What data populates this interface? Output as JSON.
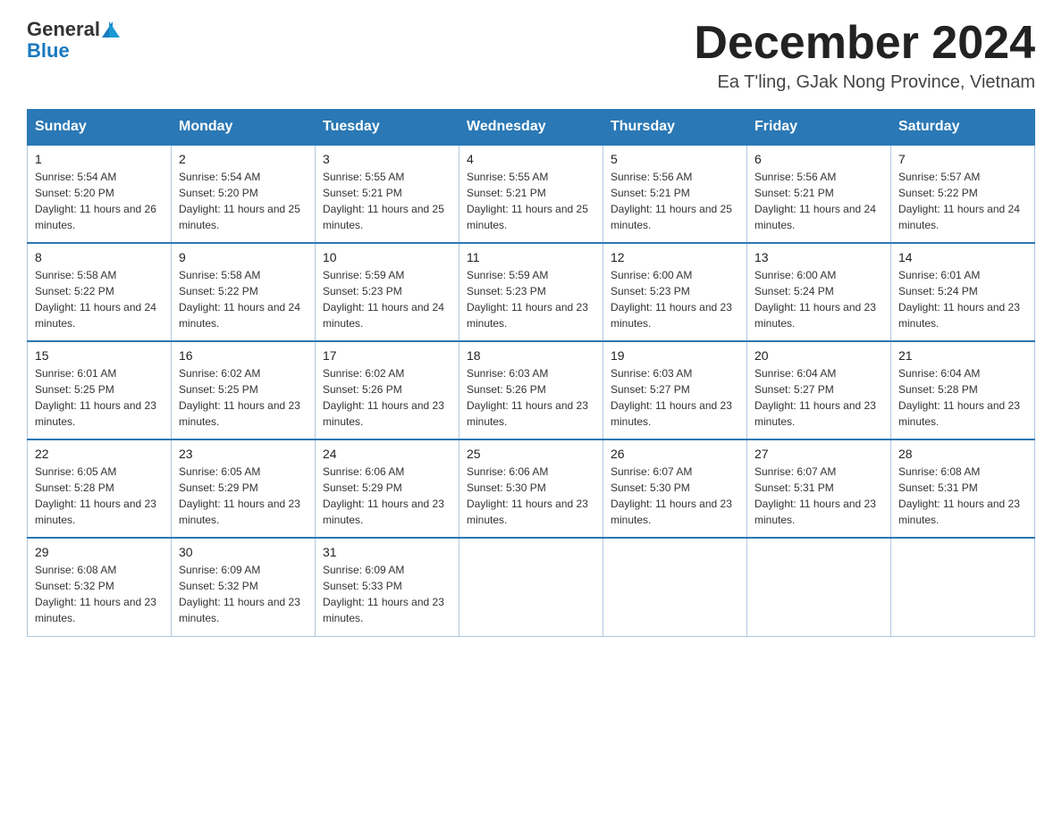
{
  "logo": {
    "general": "General",
    "blue": "Blue"
  },
  "header": {
    "month": "December 2024",
    "location": "Ea T'ling, GJak Nong Province, Vietnam"
  },
  "weekdays": [
    "Sunday",
    "Monday",
    "Tuesday",
    "Wednesday",
    "Thursday",
    "Friday",
    "Saturday"
  ],
  "weeks": [
    [
      {
        "day": 1,
        "sunrise": "5:54 AM",
        "sunset": "5:20 PM",
        "daylight": "11 hours and 26 minutes."
      },
      {
        "day": 2,
        "sunrise": "5:54 AM",
        "sunset": "5:20 PM",
        "daylight": "11 hours and 25 minutes."
      },
      {
        "day": 3,
        "sunrise": "5:55 AM",
        "sunset": "5:21 PM",
        "daylight": "11 hours and 25 minutes."
      },
      {
        "day": 4,
        "sunrise": "5:55 AM",
        "sunset": "5:21 PM",
        "daylight": "11 hours and 25 minutes."
      },
      {
        "day": 5,
        "sunrise": "5:56 AM",
        "sunset": "5:21 PM",
        "daylight": "11 hours and 25 minutes."
      },
      {
        "day": 6,
        "sunrise": "5:56 AM",
        "sunset": "5:21 PM",
        "daylight": "11 hours and 24 minutes."
      },
      {
        "day": 7,
        "sunrise": "5:57 AM",
        "sunset": "5:22 PM",
        "daylight": "11 hours and 24 minutes."
      }
    ],
    [
      {
        "day": 8,
        "sunrise": "5:58 AM",
        "sunset": "5:22 PM",
        "daylight": "11 hours and 24 minutes."
      },
      {
        "day": 9,
        "sunrise": "5:58 AM",
        "sunset": "5:22 PM",
        "daylight": "11 hours and 24 minutes."
      },
      {
        "day": 10,
        "sunrise": "5:59 AM",
        "sunset": "5:23 PM",
        "daylight": "11 hours and 24 minutes."
      },
      {
        "day": 11,
        "sunrise": "5:59 AM",
        "sunset": "5:23 PM",
        "daylight": "11 hours and 23 minutes."
      },
      {
        "day": 12,
        "sunrise": "6:00 AM",
        "sunset": "5:23 PM",
        "daylight": "11 hours and 23 minutes."
      },
      {
        "day": 13,
        "sunrise": "6:00 AM",
        "sunset": "5:24 PM",
        "daylight": "11 hours and 23 minutes."
      },
      {
        "day": 14,
        "sunrise": "6:01 AM",
        "sunset": "5:24 PM",
        "daylight": "11 hours and 23 minutes."
      }
    ],
    [
      {
        "day": 15,
        "sunrise": "6:01 AM",
        "sunset": "5:25 PM",
        "daylight": "11 hours and 23 minutes."
      },
      {
        "day": 16,
        "sunrise": "6:02 AM",
        "sunset": "5:25 PM",
        "daylight": "11 hours and 23 minutes."
      },
      {
        "day": 17,
        "sunrise": "6:02 AM",
        "sunset": "5:26 PM",
        "daylight": "11 hours and 23 minutes."
      },
      {
        "day": 18,
        "sunrise": "6:03 AM",
        "sunset": "5:26 PM",
        "daylight": "11 hours and 23 minutes."
      },
      {
        "day": 19,
        "sunrise": "6:03 AM",
        "sunset": "5:27 PM",
        "daylight": "11 hours and 23 minutes."
      },
      {
        "day": 20,
        "sunrise": "6:04 AM",
        "sunset": "5:27 PM",
        "daylight": "11 hours and 23 minutes."
      },
      {
        "day": 21,
        "sunrise": "6:04 AM",
        "sunset": "5:28 PM",
        "daylight": "11 hours and 23 minutes."
      }
    ],
    [
      {
        "day": 22,
        "sunrise": "6:05 AM",
        "sunset": "5:28 PM",
        "daylight": "11 hours and 23 minutes."
      },
      {
        "day": 23,
        "sunrise": "6:05 AM",
        "sunset": "5:29 PM",
        "daylight": "11 hours and 23 minutes."
      },
      {
        "day": 24,
        "sunrise": "6:06 AM",
        "sunset": "5:29 PM",
        "daylight": "11 hours and 23 minutes."
      },
      {
        "day": 25,
        "sunrise": "6:06 AM",
        "sunset": "5:30 PM",
        "daylight": "11 hours and 23 minutes."
      },
      {
        "day": 26,
        "sunrise": "6:07 AM",
        "sunset": "5:30 PM",
        "daylight": "11 hours and 23 minutes."
      },
      {
        "day": 27,
        "sunrise": "6:07 AM",
        "sunset": "5:31 PM",
        "daylight": "11 hours and 23 minutes."
      },
      {
        "day": 28,
        "sunrise": "6:08 AM",
        "sunset": "5:31 PM",
        "daylight": "11 hours and 23 minutes."
      }
    ],
    [
      {
        "day": 29,
        "sunrise": "6:08 AM",
        "sunset": "5:32 PM",
        "daylight": "11 hours and 23 minutes."
      },
      {
        "day": 30,
        "sunrise": "6:09 AM",
        "sunset": "5:32 PM",
        "daylight": "11 hours and 23 minutes."
      },
      {
        "day": 31,
        "sunrise": "6:09 AM",
        "sunset": "5:33 PM",
        "daylight": "11 hours and 23 minutes."
      },
      null,
      null,
      null,
      null
    ]
  ]
}
